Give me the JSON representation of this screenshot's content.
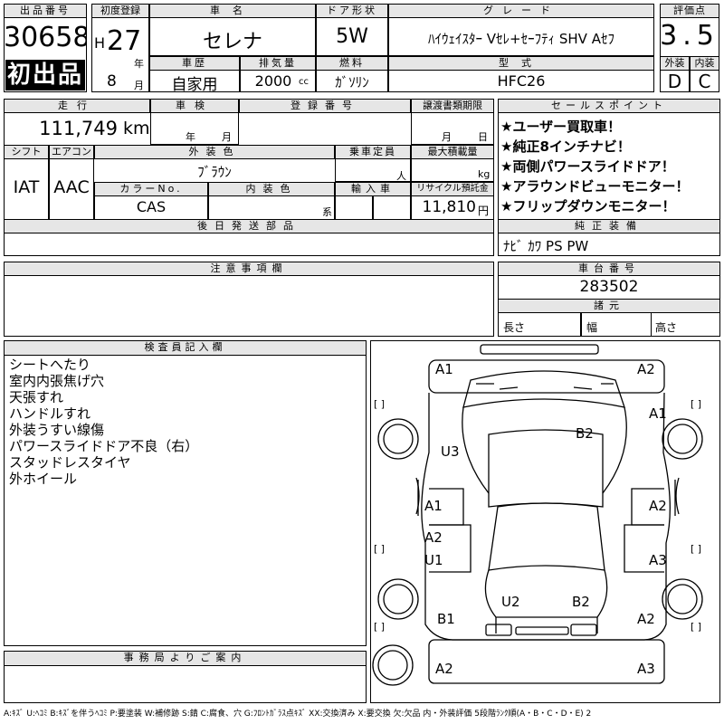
{
  "header": {
    "lot_label": "出品番号",
    "lot_number": "30658",
    "first_listing": "初出品",
    "reg_label": "初度登録",
    "era": "H",
    "year": "27",
    "year_unit": "年",
    "month": "8",
    "month_unit": "月",
    "car_name_label": "車名",
    "car_name": "セレナ",
    "door_label": "ドア形状",
    "door": "5W",
    "grade_label": "グレード",
    "grade": "ﾊｲｳｪｲｽﾀｰ Vｾﾚ+ｾｰﾌﾃｨ SHV Aｾﾌ",
    "score_label": "評価点",
    "score": "3.5",
    "history_label": "車歴",
    "history": "自家用",
    "displacement_label": "排気量",
    "displacement": "2000",
    "displacement_unit": "cc",
    "fuel_label": "燃料",
    "fuel": "ｶﾞｿﾘﾝ",
    "model_label": "型式",
    "model": "HFC26",
    "exterior_label": "外装",
    "exterior_grade": "D",
    "interior_label": "内装",
    "interior_grade": "C"
  },
  "info": {
    "mileage_label": "走行",
    "mileage": "111,749",
    "mileage_unit": "km",
    "inspection_label": "車検",
    "insp_year_unit": "年",
    "insp_month_unit": "月",
    "reg_no_label": "登録番号",
    "transfer_label": "譲渡書類期限",
    "transfer_month_unit": "月",
    "transfer_day_unit": "日",
    "shift_label": "シフト",
    "shift": "IAT",
    "ac_label": "エアコン",
    "ac": "AAC",
    "ext_color_label": "外装色",
    "ext_color": "ﾌﾞﾗｳﾝ",
    "capacity_label": "乗車定員",
    "capacity_unit": "人",
    "load_label": "最大積載量",
    "load_unit": "kg",
    "color_no_label": "カラーNo.",
    "color_no": "CAS",
    "int_color_label": "内装色",
    "int_color_unit": "系",
    "import_label": "輸入車",
    "recycle_label": "リサイクル預託金",
    "recycle": "11,810",
    "recycle_unit": "円",
    "later_label": "後日発送部品"
  },
  "sales_points": {
    "label": "セールスポイント",
    "items": [
      "★ユーザー買取車！",
      "★純正8インチナビ！",
      "★両側パワースライドドア！",
      "★アラウンドビューモニター！",
      "★フリップダウンモニター！"
    ]
  },
  "equipment": {
    "label": "純正装備",
    "value": "ﾅﾋﾞ ｶﾜ PS PW"
  },
  "notes": {
    "label": "注意事項欄"
  },
  "chassis": {
    "label": "車台番号",
    "value": "283502",
    "dims_label": "諸元",
    "length_label": "長さ",
    "width_label": "幅",
    "height_label": "高さ"
  },
  "inspector": {
    "label": "検査員記入欄",
    "items": [
      "シートへたり",
      "室内内張焦げ穴",
      "天張すれ",
      "ハンドルすれ",
      "外装うすい線傷",
      "パワースライドドア不良（右）",
      "スタッドレスタイヤ",
      "外ホイール"
    ]
  },
  "office": {
    "label": "事務局よりご案内"
  },
  "diagram": {
    "codes": [
      "A1",
      "A2",
      "A1",
      "U3",
      "B2",
      "A1",
      "A2",
      "A2",
      "U1",
      "A3",
      "U2",
      "B2",
      "B1",
      "A2",
      "A2",
      "A3"
    ],
    "bracket": "[ ]"
  },
  "legend": "A:ｷｽﾞ U:ﾍｺﾐ B:ｷｽﾞを伴うﾍｺﾐ P:要塗装 W:補修跡 S:錆 C:腐食、穴 G:ﾌﾛﾝﾄｶﾞﾗｽ点ｷｽﾞ XX:交換済み X:要交換 欠:欠品 内・外装評価 5段階ﾗﾝｸ順(A・B・C・D・E) 2"
}
